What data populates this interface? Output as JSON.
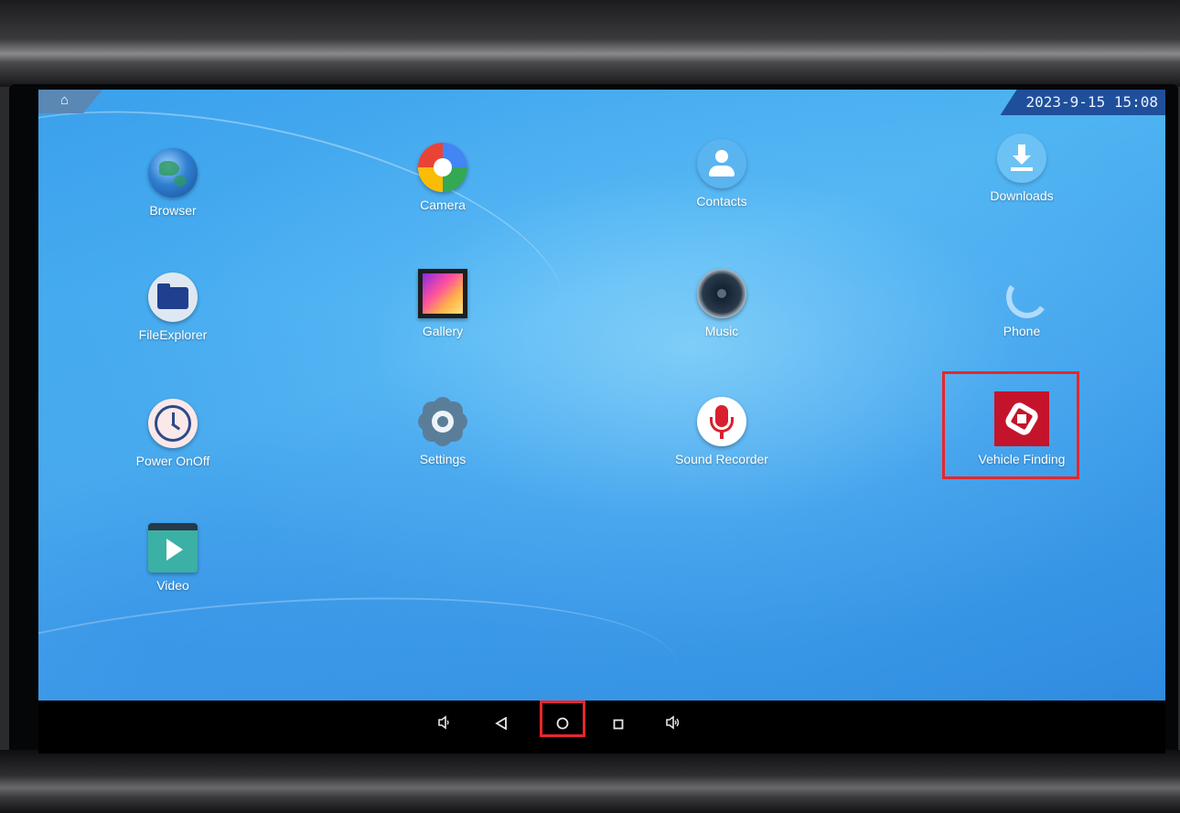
{
  "status_bar": {
    "datetime": "2023-9-15 15:08",
    "home_icon": "home-icon"
  },
  "apps": [
    {
      "label": "Browser",
      "icon": "globe-icon"
    },
    {
      "label": "Camera",
      "icon": "camera-shutter-icon"
    },
    {
      "label": "Contacts",
      "icon": "contact-person-icon"
    },
    {
      "label": "Downloads",
      "icon": "download-arrow-icon"
    },
    {
      "label": "FileExplorer",
      "icon": "folder-icon"
    },
    {
      "label": "Gallery",
      "icon": "picture-icon"
    },
    {
      "label": "Music",
      "icon": "speaker-icon"
    },
    {
      "label": "Phone",
      "icon": "phone-handset-icon"
    },
    {
      "label": "Power OnOff",
      "icon": "clock-icon"
    },
    {
      "label": "Settings",
      "icon": "gear-icon"
    },
    {
      "label": "Sound Recorder",
      "icon": "microphone-icon"
    },
    {
      "label": "Vehicle Finding",
      "icon": "vehicle-finding-logo-icon"
    },
    {
      "label": "Video",
      "icon": "play-icon"
    }
  ],
  "navbar": {
    "buttons": [
      "volume-down-icon",
      "back-icon",
      "home-circle-icon",
      "recents-icon",
      "volume-up-icon"
    ]
  },
  "colors": {
    "highlight": "#e8262a",
    "wallpaper": "#4fb4f2",
    "vehicle_finding_bg": "#c4142b"
  }
}
